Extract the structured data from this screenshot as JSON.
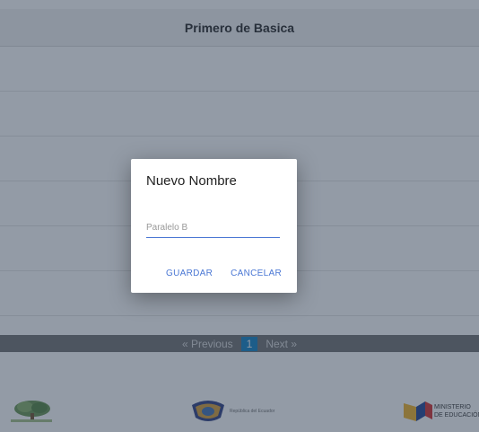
{
  "header": {
    "title": "Primero de Basica"
  },
  "pagination": {
    "previous": "« Previous",
    "current": "1",
    "next": "Next »"
  },
  "footer": {
    "logo_left_icon": "family-tree-logo-icon",
    "logo_center_text": "República del Ecuador",
    "logo_right_text_1": "MINISTERIO",
    "logo_right_text_2": "DE EDUCACIÓN"
  },
  "dialog": {
    "title": "Nuevo Nombre",
    "input_value": "",
    "input_placeholder": "Paralelo B",
    "save_label": "GUARDAR",
    "cancel_label": "CANCELAR"
  },
  "colors": {
    "accent": "#4a77d4",
    "pager_bg": "#7a7a7a",
    "pager_active": "#1e88c8"
  }
}
